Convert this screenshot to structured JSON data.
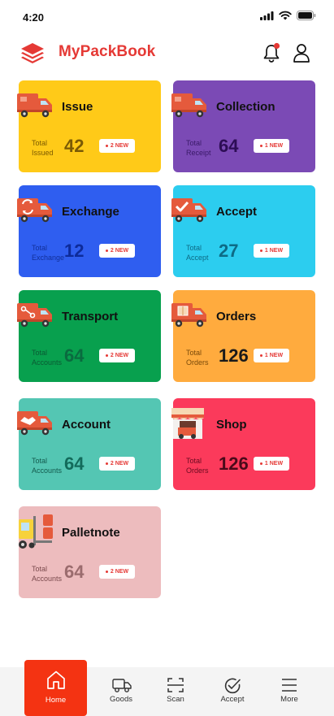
{
  "status": {
    "time": "4:20"
  },
  "header": {
    "title": "MyPackBook"
  },
  "colors": {
    "brand": "#e53935",
    "home_active": "#f43312"
  },
  "cards": [
    {
      "title": "Issue",
      "sub1": "Total",
      "sub2": "Issued",
      "value": "42",
      "badge": "2 NEW",
      "bg": "#ffca18",
      "value_color": "#7a5a05",
      "sub_color": "#7b5a00",
      "icon": "delivery-truck-icon"
    },
    {
      "title": "Collection",
      "sub1": "Total",
      "sub2": "Receipt",
      "value": "64",
      "badge": "1 NEW",
      "bg": "#7b4ab5",
      "value_color": "#2d0d55",
      "sub_color": "#3a1a68",
      "icon": "delivery-truck-icon"
    },
    {
      "title": "Exchange",
      "sub1": "Total",
      "sub2": "Exchange",
      "value": "12",
      "badge": "2 NEW",
      "bg": "#2f5ef0",
      "value_color": "#0d2b9a",
      "sub_color": "#12309a",
      "icon": "exchange-truck-icon"
    },
    {
      "title": "Accept",
      "sub1": "Total",
      "sub2": "Accept",
      "value": "27",
      "badge": "1 NEW",
      "bg": "#2ccdef",
      "value_color": "#0d6b86",
      "sub_color": "#0d6b86",
      "icon": "accept-truck-icon"
    },
    {
      "title": "Transport",
      "sub1": "Total",
      "sub2": "Accounts",
      "value": "64",
      "badge": "2 NEW",
      "bg": "#08a04e",
      "value_color": "#0a6b3f",
      "sub_color": "#0a5a33",
      "icon": "transport-truck-icon"
    },
    {
      "title": "Orders",
      "sub1": "Total",
      "sub2": "Orders",
      "value": "126",
      "badge": "1 NEW",
      "bg": "#ffab3e",
      "value_color": "#1a1a1a",
      "sub_color": "#7a4a0a",
      "icon": "orders-truck-icon"
    },
    {
      "title": "Account",
      "sub1": "Total",
      "sub2": "Accounts",
      "value": "64",
      "badge": "2 NEW",
      "bg": "#54c6b3",
      "value_color": "#136b5b",
      "sub_color": "#135a4d",
      "icon": "handshake-truck-icon"
    },
    {
      "title": "Shop",
      "sub1": "Total",
      "sub2": "Orders",
      "value": "126",
      "badge": "1 NEW",
      "bg": "#fb3a5b",
      "value_color": "#4a0a1a",
      "sub_color": "#6a0a20",
      "icon": "shop-icon"
    },
    {
      "title": "Palletnote",
      "sub1": "Total",
      "sub2": "Accounts",
      "value": "64",
      "badge": "2 NEW",
      "bg": "#edbcbe",
      "value_color": "#9b6c6e",
      "sub_color": "#7a4a4d",
      "icon": "forklift-icon"
    }
  ],
  "nav": [
    {
      "label": "Home",
      "icon": "home-icon",
      "active": true
    },
    {
      "label": "Goods",
      "icon": "truck-icon"
    },
    {
      "label": "Scan",
      "icon": "scan-icon"
    },
    {
      "label": "Accept",
      "icon": "check-circle-icon"
    },
    {
      "label": "More",
      "icon": "menu-icon"
    }
  ]
}
